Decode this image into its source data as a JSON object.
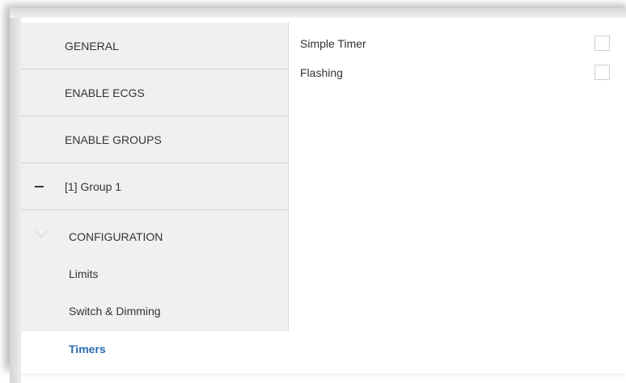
{
  "sidebar": {
    "items": [
      {
        "label": "GENERAL"
      },
      {
        "label": "ENABLE ECGS"
      },
      {
        "label": "ENABLE GROUPS"
      },
      {
        "label": "[1] Group 1"
      }
    ],
    "subitems": [
      {
        "label": "CONFIGURATION"
      },
      {
        "label": "Limits"
      },
      {
        "label": "Switch & Dimming"
      },
      {
        "label": "Timers"
      }
    ],
    "active": "Timers"
  },
  "content": {
    "params": [
      {
        "label": "Simple Timer",
        "checked": false
      },
      {
        "label": "Flashing",
        "checked": false
      }
    ]
  },
  "colors": {
    "active_text": "#2b6cb3",
    "sidebar_bg": "#f0f0f0"
  }
}
